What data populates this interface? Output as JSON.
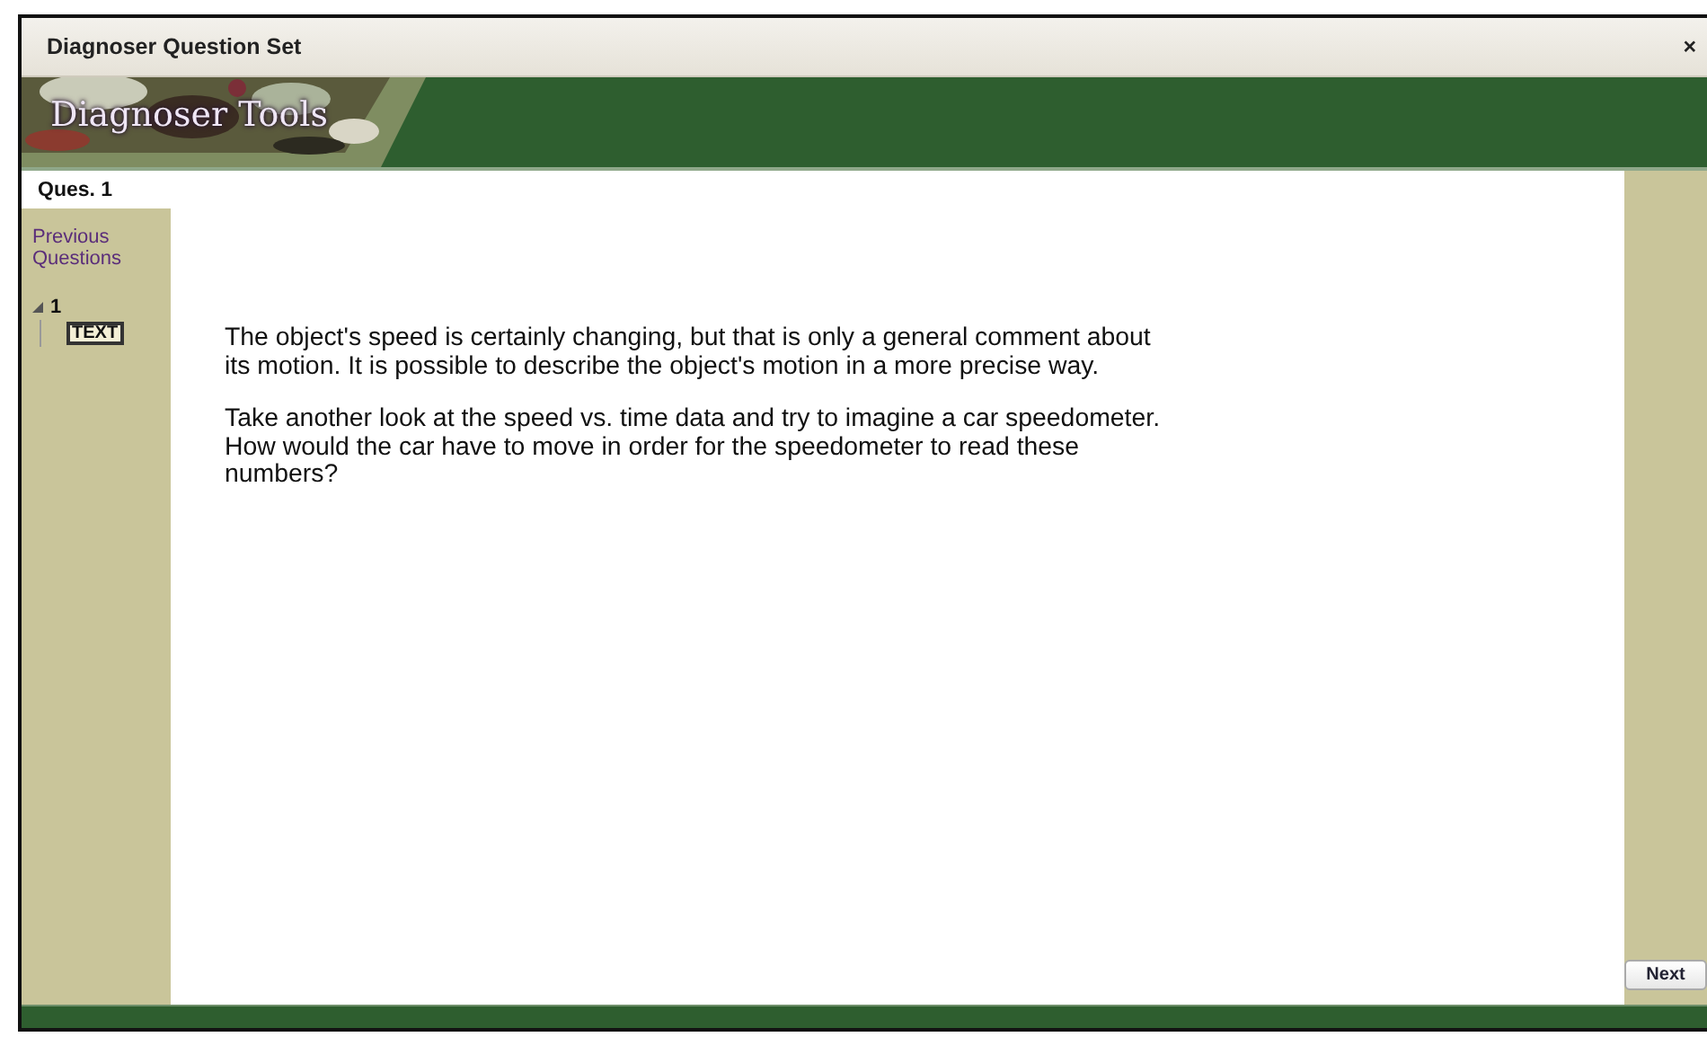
{
  "window": {
    "title": "Diagnoser Question Set",
    "close": "×"
  },
  "banner": {
    "logo": "Diagnoser Tools"
  },
  "tab": {
    "label": "Ques. 1"
  },
  "sidebar": {
    "heading": "Previous Questions",
    "tree": [
      {
        "label": "1",
        "expanded": true,
        "children": [
          {
            "label": "TEXT",
            "selected": true
          }
        ]
      }
    ]
  },
  "content": {
    "paragraphs": [
      "The object's speed is certainly changing, but that is only a general comment about its motion. It is possible to describe the object's motion in a more precise way.",
      "Take another look at the speed vs. time data and try to imagine a car speedometer. How would the car have to move in order for the speedometer to read these numbers?"
    ]
  },
  "buttons": {
    "next": "Next"
  }
}
